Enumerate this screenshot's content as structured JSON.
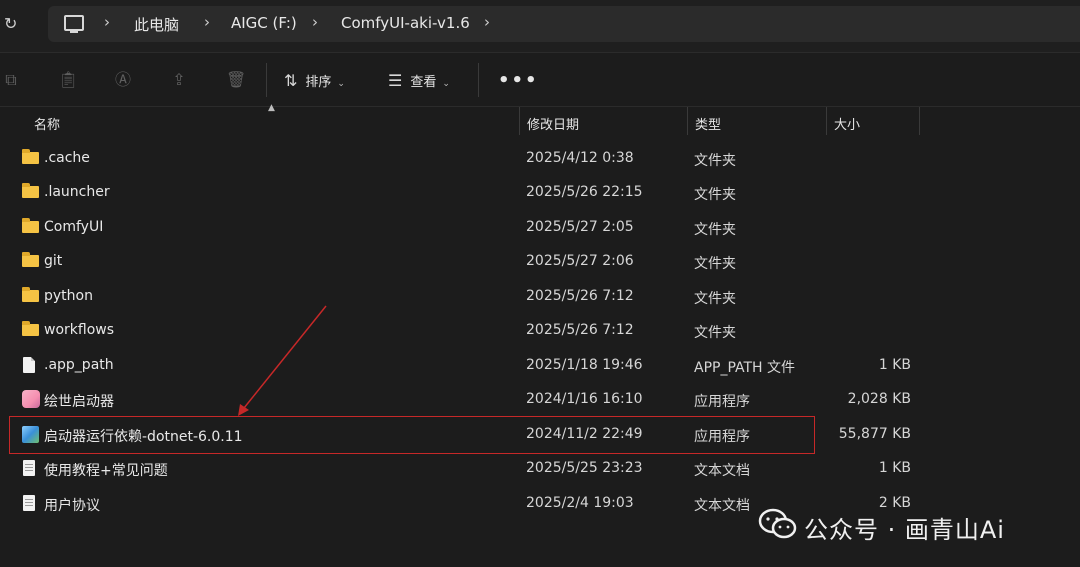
{
  "breadcrumb": [
    "此电脑",
    "AIGC (F:)",
    "ComfyUI-aki-v1.6"
  ],
  "toolbar": {
    "sort_label": "排序",
    "view_label": "查看",
    "more_label": "•••"
  },
  "columns": {
    "name": "名称",
    "date": "修改日期",
    "type": "类型",
    "size": "大小"
  },
  "files": [
    {
      "name": ".cache",
      "date": "2025/4/12 0:38",
      "type": "文件夹",
      "size": "",
      "icon": "folder-icon"
    },
    {
      "name": ".launcher",
      "date": "2025/5/26 22:15",
      "type": "文件夹",
      "size": "",
      "icon": "folder-icon"
    },
    {
      "name": "ComfyUI",
      "date": "2025/5/27 2:05",
      "type": "文件夹",
      "size": "",
      "icon": "folder-icon"
    },
    {
      "name": "git",
      "date": "2025/5/27 2:06",
      "type": "文件夹",
      "size": "",
      "icon": "folder-icon"
    },
    {
      "name": "python",
      "date": "2025/5/26 7:12",
      "type": "文件夹",
      "size": "",
      "icon": "folder-icon"
    },
    {
      "name": "workflows",
      "date": "2025/5/26 7:12",
      "type": "文件夹",
      "size": "",
      "icon": "folder-icon"
    },
    {
      "name": ".app_path",
      "date": "2025/1/18 19:46",
      "type": "APP_PATH 文件",
      "size": "1 KB",
      "icon": "file-icon"
    },
    {
      "name": "绘世启动器",
      "date": "2024/1/16 16:10",
      "type": "应用程序",
      "size": "2,028 KB",
      "icon": "app-icon"
    },
    {
      "name": "启动器运行依赖-dotnet-6.0.11",
      "date": "2024/11/2 22:49",
      "type": "应用程序",
      "size": "55,877 KB",
      "icon": "setup-icon"
    },
    {
      "name": "使用教程+常见问题",
      "date": "2025/5/25 23:23",
      "type": "文本文档",
      "size": "1 KB",
      "icon": "doc-icon"
    },
    {
      "name": "用户协议",
      "date": "2025/2/4 19:03",
      "type": "文本文档",
      "size": "2 KB",
      "icon": "doc-icon"
    }
  ],
  "watermark": {
    "text": "公众号 · 画青山Ai"
  },
  "colors": {
    "background": "#1c1c1c",
    "highlight": "#c62828",
    "folder": "#f5c344"
  }
}
